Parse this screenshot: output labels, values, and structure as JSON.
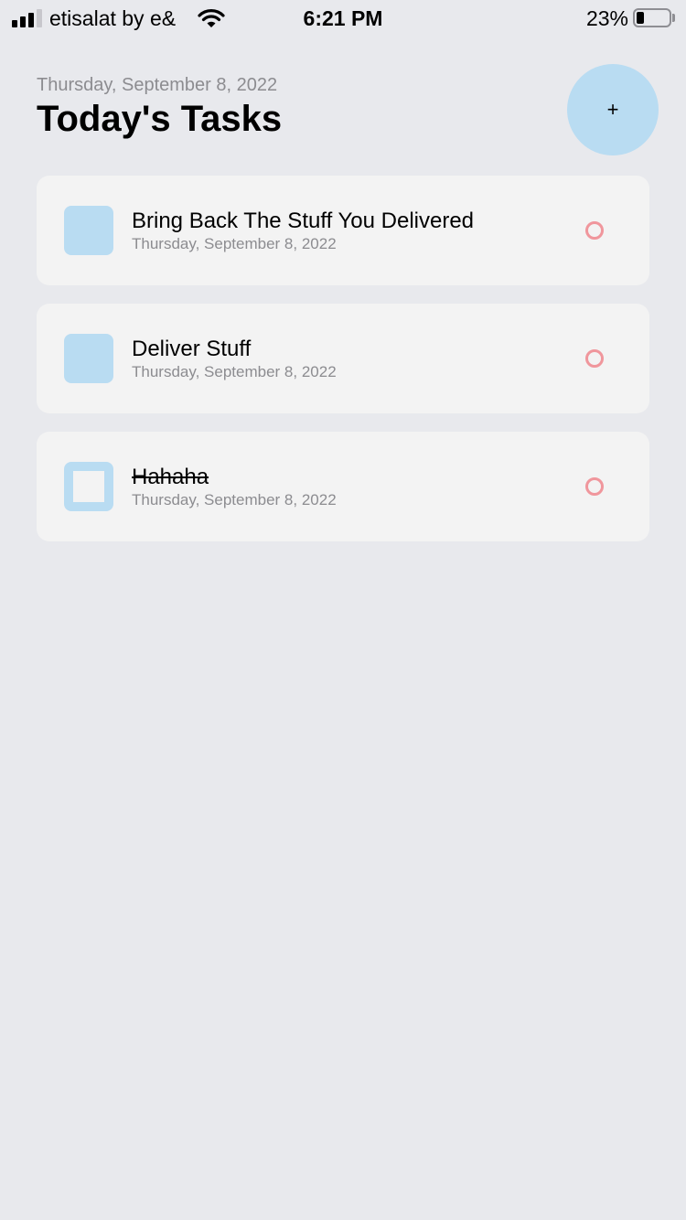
{
  "status_bar": {
    "carrier": "etisalat by e&",
    "time": "6:21 PM",
    "battery_percent": "23%",
    "battery_level": 0.23,
    "signal_bars_active": 3,
    "signal_bars_total": 4,
    "icons": [
      "signal-icon",
      "wifi-icon",
      "battery-icon"
    ]
  },
  "header": {
    "date": "Thursday, September 8, 2022",
    "title": "Today's Tasks",
    "add_label": "+"
  },
  "tasks": [
    {
      "title": "Bring Back The Stuff You Delivered",
      "date": "Thursday, September 8, 2022",
      "completed": false
    },
    {
      "title": "Deliver Stuff",
      "date": "Thursday, September 8, 2022",
      "completed": false
    },
    {
      "title": "Hahaha",
      "date": "Thursday, September 8, 2022",
      "completed": true
    }
  ],
  "colors": {
    "background": "#e8e9ed",
    "card": "#f3f3f3",
    "accent_blue": "#b9dcf2",
    "indicator_pink": "#f0969c",
    "secondary_text": "#8c8c90"
  }
}
